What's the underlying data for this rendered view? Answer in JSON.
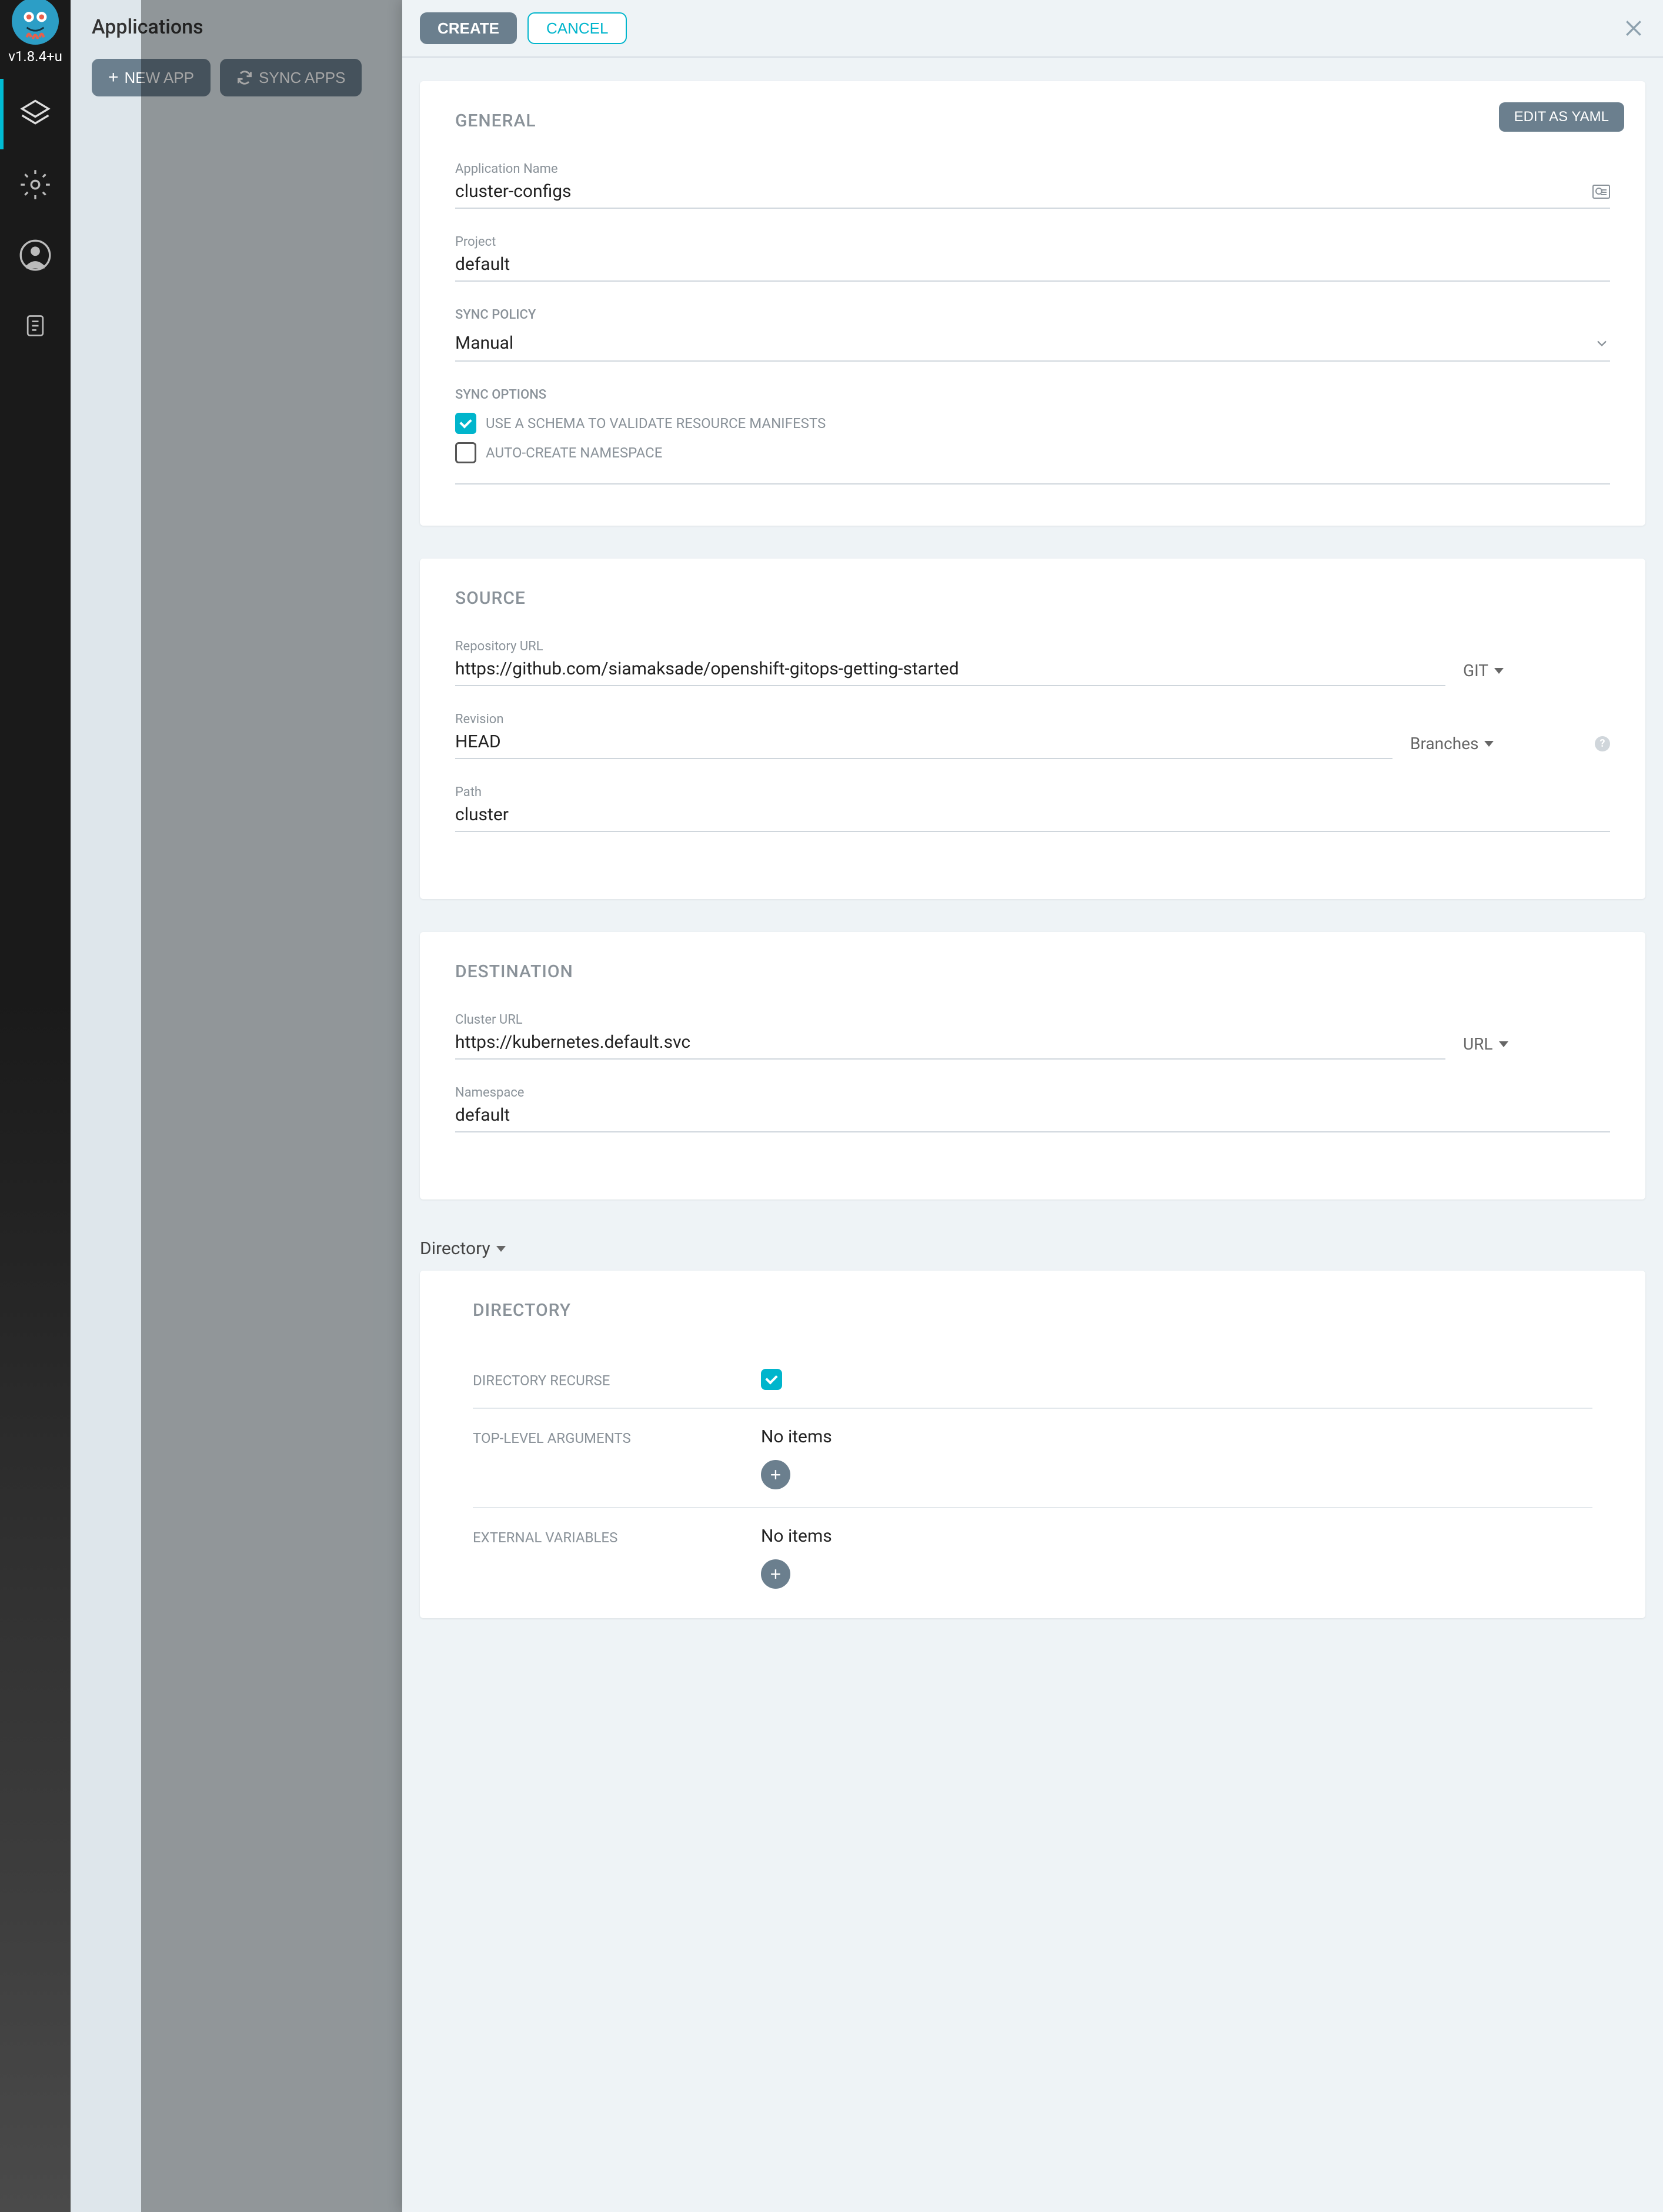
{
  "version": "v1.8.4+u",
  "page_title": "Applications",
  "toolbar": {
    "new_app": "NEW APP",
    "sync_apps": "SYNC APPS"
  },
  "panel": {
    "create": "CREATE",
    "cancel": "CANCEL",
    "edit_yaml": "EDIT AS YAML"
  },
  "general": {
    "title": "GENERAL",
    "app_name_label": "Application Name",
    "app_name_value": "cluster-configs",
    "project_label": "Project",
    "project_value": "default",
    "sync_policy_label": "SYNC POLICY",
    "sync_policy_value": "Manual",
    "sync_options_label": "SYNC OPTIONS",
    "opt_schema": "USE A SCHEMA TO VALIDATE RESOURCE MANIFESTS",
    "opt_autons": "AUTO-CREATE NAMESPACE"
  },
  "source": {
    "title": "SOURCE",
    "repo_label": "Repository URL",
    "repo_value": "https://github.com/siamaksade/openshift-gitops-getting-started",
    "repo_type": "GIT",
    "rev_label": "Revision",
    "rev_value": "HEAD",
    "rev_type": "Branches",
    "path_label": "Path",
    "path_value": "cluster"
  },
  "destination": {
    "title": "DESTINATION",
    "cluster_label": "Cluster URL",
    "cluster_value": "https://kubernetes.default.svc",
    "cluster_type": "URL",
    "ns_label": "Namespace",
    "ns_value": "default"
  },
  "directory": {
    "dropdown": "Directory",
    "title": "DIRECTORY",
    "recurse_label": "DIRECTORY RECURSE",
    "tla_label": "TOP-LEVEL ARGUMENTS",
    "ext_label": "EXTERNAL VARIABLES",
    "no_items": "No items"
  }
}
